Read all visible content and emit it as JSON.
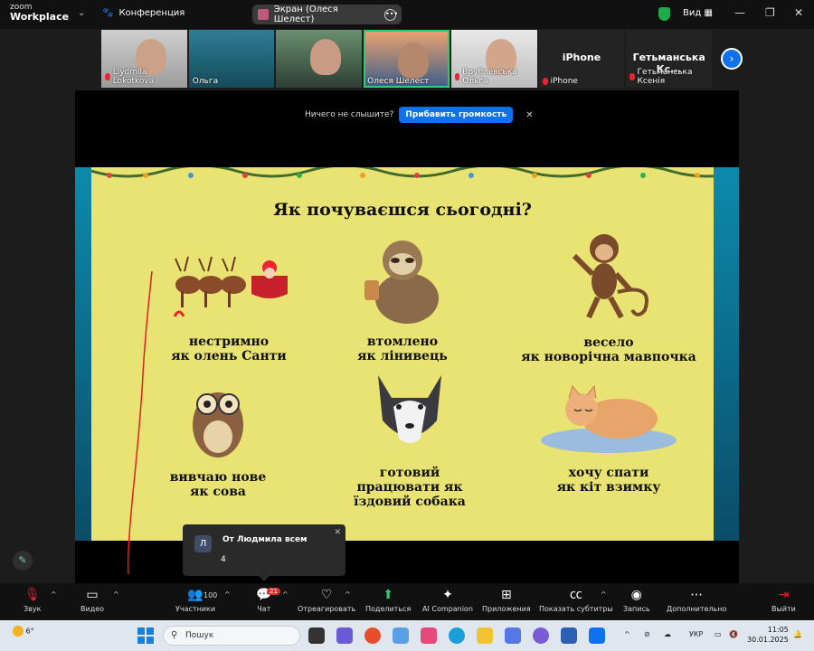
{
  "titlebar": {
    "brand_line1": "zoom",
    "brand_line2": "Workplace",
    "meeting_label": "Конференция",
    "screen_share_label": "Экран (Олеся Шелест)",
    "view_label": "Вид"
  },
  "participants": [
    {
      "name": "Liydmila Lokotkova",
      "muted": true
    },
    {
      "name": "Ольга",
      "muted": false
    },
    {
      "name": "",
      "muted": false
    },
    {
      "name": "Олеся Шелест",
      "muted": false,
      "active": true
    },
    {
      "name": "Врублевська Ольга",
      "muted": true
    },
    {
      "name": "iPhone",
      "big_label": "iPhone",
      "muted": true
    },
    {
      "name": "Гетьманська Ксенія",
      "big_label": "Гетьманська Кс...",
      "muted": true
    }
  ],
  "audio_banner": {
    "text": "Ничего не слышите?",
    "button": "Прибавить громкость"
  },
  "slide": {
    "title": "Як почуваєшся сьогодні?",
    "items": [
      {
        "line1": "нестримно",
        "line2": "як олень Санти",
        "line3": "",
        "icon": "reindeer-sleigh-picture"
      },
      {
        "line1": "втомлено",
        "line2": "як лінивець",
        "line3": "",
        "icon": "sloth-picture"
      },
      {
        "line1": "весело",
        "line2": "як новорічна мавпочка",
        "line3": "",
        "icon": "monkey-picture"
      },
      {
        "line1": "вивчаю нове",
        "line2": "як сова",
        "line3": "",
        "icon": "owl-picture"
      },
      {
        "line1": "готовий",
        "line2": "працювати як",
        "line3": "їздовий собака",
        "icon": "husky-picture"
      },
      {
        "line1": "хочу спати",
        "line2": "як кіт взимку",
        "line3": "",
        "icon": "sleeping-cat-picture"
      }
    ]
  },
  "chat_toast": {
    "avatar": "Л",
    "from": "От Людмила всем",
    "message": "4"
  },
  "toolbar": {
    "audio": "Звук",
    "video": "Видео",
    "participants": "Участники",
    "participants_count": "100",
    "chat": "Чат",
    "chat_badge": "21",
    "react": "Отреагировать",
    "share": "Поделиться",
    "ai": "AI Companion",
    "apps": "Приложения",
    "captions": "Показать субтитры",
    "record": "Запись",
    "more": "Дополнительно",
    "leave": "Выйти"
  },
  "taskbar": {
    "weather_temp": "6°",
    "search_placeholder": "Пошук",
    "lang": "УКР",
    "time": "11:05",
    "date": "30.01.2025"
  },
  "colors": {
    "accent_blue": "#0e72ed",
    "active_green": "#2ecc71",
    "slide_yellow": "#e9e373",
    "mute_red": "#e22d2d"
  }
}
